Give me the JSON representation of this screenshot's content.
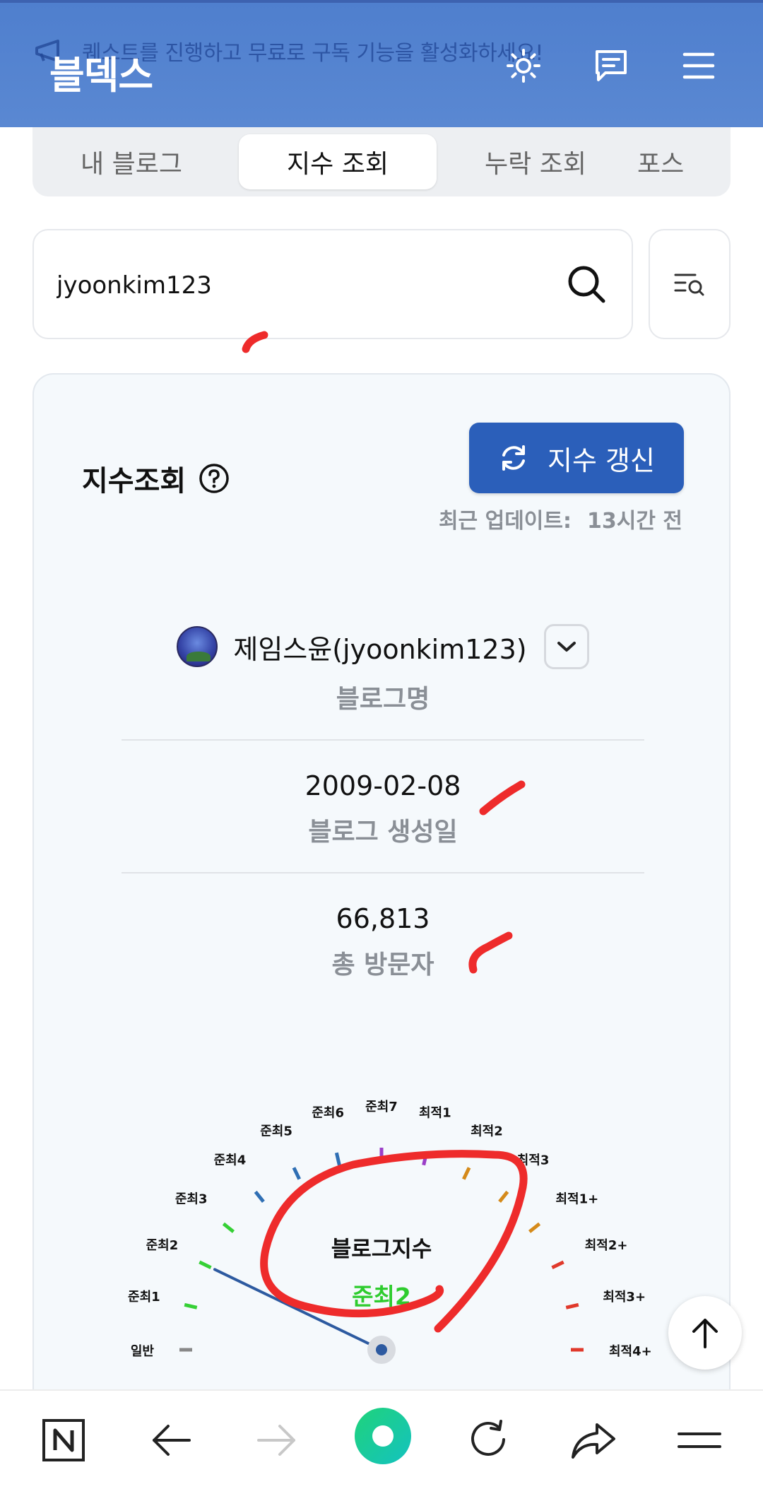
{
  "header": {
    "brand": "블덱스",
    "banner_text": "퀘스트를 진행하고 무료로 구독 기능을 활성화하세요!",
    "icons": [
      "sun-icon",
      "chat-icon",
      "menu-icon"
    ]
  },
  "tabs": [
    {
      "label": "내 블로그",
      "active": false
    },
    {
      "label": "지수 조회",
      "active": true
    },
    {
      "label": "누락 조회",
      "active": false
    },
    {
      "label": "포스",
      "active": false
    }
  ],
  "search": {
    "value": "jyoonkim123",
    "placeholder": ""
  },
  "card": {
    "title": "지수조회",
    "refresh_label": "지수 갱신",
    "updated_label": "최근 업데이트:",
    "updated_value": "13시간 전",
    "blog_name": "제임스윤(jyoonkim123)",
    "blog_name_label": "블로그명",
    "created_date": "2009-02-08",
    "created_label": "블로그 생성일",
    "visitors": "66,813",
    "visitors_label": "총 방문자"
  },
  "gauge": {
    "title": "블로그지수",
    "current": "준최2",
    "current_color": "#2ecc2e",
    "needle_level": 2,
    "levels": [
      {
        "label": "일반",
        "color": "#888888"
      },
      {
        "label": "준최1",
        "color": "#35d035"
      },
      {
        "label": "준최2",
        "color": "#35d035"
      },
      {
        "label": "준최3",
        "color": "#35d035"
      },
      {
        "label": "준최4",
        "color": "#2f6fb4"
      },
      {
        "label": "준최5",
        "color": "#2f6fb4"
      },
      {
        "label": "준최6",
        "color": "#2f6fb4"
      },
      {
        "label": "준최7",
        "color": "#9b3fc8"
      },
      {
        "label": "최적1",
        "color": "#9b3fc8"
      },
      {
        "label": "최적2",
        "color": "#d58a1a"
      },
      {
        "label": "최적3",
        "color": "#d58a1a"
      },
      {
        "label": "최적1+",
        "color": "#d58a1a"
      },
      {
        "label": "최적2+",
        "color": "#e0392b"
      },
      {
        "label": "최적3+",
        "color": "#e0392b"
      },
      {
        "label": "최적4+",
        "color": "#e0392b"
      }
    ]
  },
  "bottom_nav": {
    "icons": [
      "n-logo-icon",
      "back-arrow-icon",
      "forward-arrow-icon",
      "home-circle-icon",
      "reload-icon",
      "share-icon",
      "menu-lines-icon"
    ]
  },
  "colors": {
    "header_bg": "#5585d0",
    "accent": "#2b5fba",
    "annotation": "#ee2b2b"
  }
}
